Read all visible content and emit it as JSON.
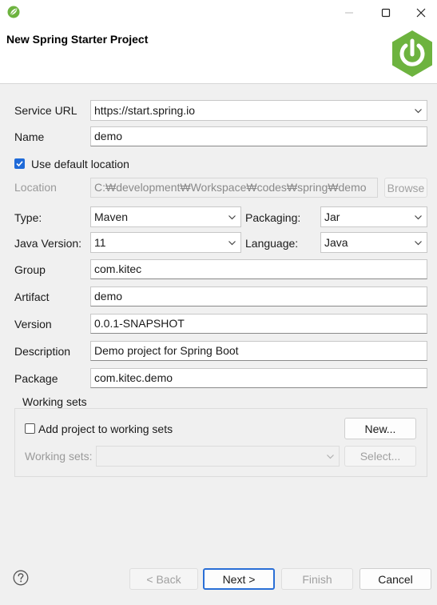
{
  "window": {
    "title": "New Spring Starter Project"
  },
  "form": {
    "service_url_label": "Service URL",
    "service_url_value": "https://start.spring.io",
    "name_label": "Name",
    "name_value": "demo",
    "use_default_location_label": "Use default location",
    "use_default_location_checked": true,
    "location_label": "Location",
    "location_value": "C:₩development₩Workspace₩codes₩spring₩demo",
    "browse_label": "Browse",
    "type_label": "Type:",
    "type_value": "Maven",
    "packaging_label": "Packaging:",
    "packaging_value": "Jar",
    "java_version_label": "Java Version:",
    "java_version_value": "11",
    "language_label": "Language:",
    "language_value": "Java",
    "group_label": "Group",
    "group_value": "com.kitec",
    "artifact_label": "Artifact",
    "artifact_value": "demo",
    "version_label": "Version",
    "version_value": "0.0.1-SNAPSHOT",
    "description_label": "Description",
    "description_value": "Demo project for Spring Boot",
    "package_label": "Package",
    "package_value": "com.kitec.demo"
  },
  "working_sets": {
    "legend": "Working sets",
    "add_label": "Add project to working sets",
    "add_checked": false,
    "new_button": "New...",
    "sets_label": "Working sets:",
    "sets_value": "",
    "select_button": "Select..."
  },
  "footer": {
    "back": "< Back",
    "next": "Next >",
    "finish": "Finish",
    "cancel": "Cancel"
  },
  "icons": {
    "app": "spring-leaf-icon",
    "logo": "spring-power-icon",
    "help": "help-icon"
  },
  "colors": {
    "spring_green": "#6db33f",
    "accent_blue": "#1f6ad8"
  }
}
